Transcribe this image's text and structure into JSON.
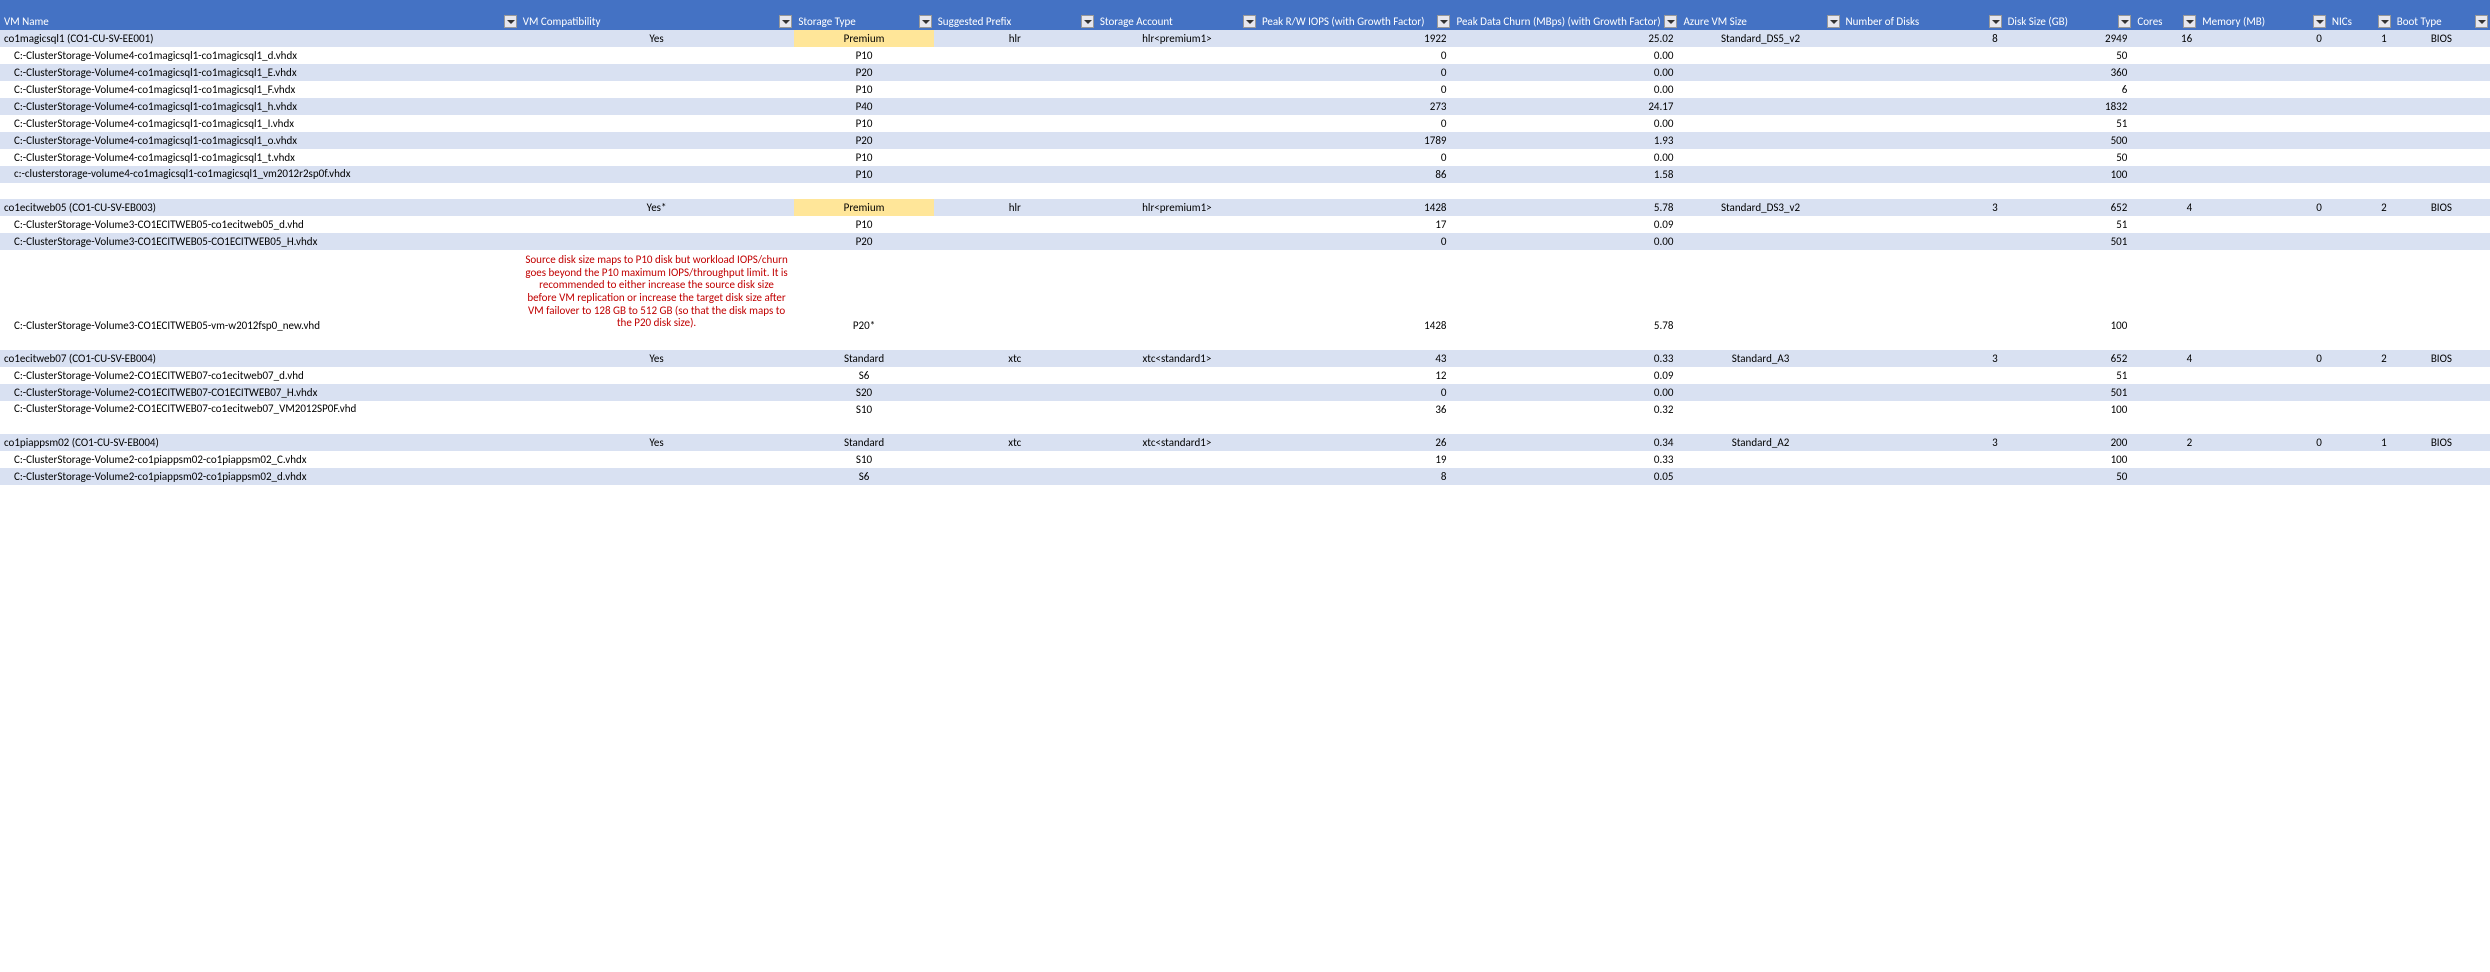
{
  "headers": [
    "VM Name",
    "VM Compatibility",
    "Storage Type",
    "Suggested Prefix",
    "Storage Account",
    "Peak R/W IOPS (with Growth Factor)",
    "Peak Data Churn (MBps) (with Growth Factor)",
    "Azure VM Size",
    "Number of Disks",
    "Disk Size (GB)",
    "Cores",
    "Memory (MB)",
    "NICs",
    "Boot Type"
  ],
  "rows": [
    {
      "band": "a",
      "premium": true,
      "c": [
        "co1magicsql1 (CO1-CU-SV-EE001)",
        "Yes",
        "Premium",
        "hlr",
        "hlr<premium1>",
        "1922",
        "25.02",
        "Standard_DS5_v2",
        "8",
        "2949",
        "16",
        "0",
        "1",
        "BIOS"
      ]
    },
    {
      "band": "b",
      "c": [
        "    C:-ClusterStorage-Volume4-co1magicsql1-co1magicsql1_d.vhdx",
        "",
        "P10",
        "",
        "",
        "0",
        "0.00",
        "",
        "",
        "50",
        "",
        "",
        "",
        ""
      ]
    },
    {
      "band": "a",
      "c": [
        "    C:-ClusterStorage-Volume4-co1magicsql1-co1magicsql1_E.vhdx",
        "",
        "P20",
        "",
        "",
        "0",
        "0.00",
        "",
        "",
        "360",
        "",
        "",
        "",
        ""
      ]
    },
    {
      "band": "b",
      "c": [
        "    C:-ClusterStorage-Volume4-co1magicsql1-co1magicsql1_F.vhdx",
        "",
        "P10",
        "",
        "",
        "0",
        "0.00",
        "",
        "",
        "6",
        "",
        "",
        "",
        ""
      ]
    },
    {
      "band": "a",
      "c": [
        "    C:-ClusterStorage-Volume4-co1magicsql1-co1magicsql1_h.vhdx",
        "",
        "P40",
        "",
        "",
        "273",
        "24.17",
        "",
        "",
        "1832",
        "",
        "",
        "",
        ""
      ]
    },
    {
      "band": "b",
      "c": [
        "    C:-ClusterStorage-Volume4-co1magicsql1-co1magicsql1_I.vhdx",
        "",
        "P10",
        "",
        "",
        "0",
        "0.00",
        "",
        "",
        "51",
        "",
        "",
        "",
        ""
      ]
    },
    {
      "band": "a",
      "c": [
        "    C:-ClusterStorage-Volume4-co1magicsql1-co1magicsql1_o.vhdx",
        "",
        "P20",
        "",
        "",
        "1789",
        "1.93",
        "",
        "",
        "500",
        "",
        "",
        "",
        ""
      ]
    },
    {
      "band": "b",
      "c": [
        "    C:-ClusterStorage-Volume4-co1magicsql1-co1magicsql1_t.vhdx",
        "",
        "P10",
        "",
        "",
        "0",
        "0.00",
        "",
        "",
        "50",
        "",
        "",
        "",
        ""
      ]
    },
    {
      "band": "a",
      "wrap0": true,
      "c": [
        "    c:-clusterstorage-volume4-co1magicsql1-co1magicsql1_vm2012r2sp0f.vhdx",
        "",
        "P10",
        "",
        "",
        "86",
        "1.58",
        "",
        "",
        "100",
        "",
        "",
        "",
        ""
      ]
    },
    {
      "blank": true
    },
    {
      "band": "a",
      "premium": true,
      "c": [
        "co1ecitweb05 (CO1-CU-SV-EB003)",
        "Yes*",
        "Premium",
        "hlr",
        "hlr<premium1>",
        "1428",
        "5.78",
        "Standard_DS3_v2",
        "3",
        "652",
        "4",
        "0",
        "2",
        "BIOS"
      ]
    },
    {
      "band": "b",
      "c": [
        "    C:-ClusterStorage-Volume3-CO1ECITWEB05-co1ecitweb05_d.vhd",
        "",
        "P10",
        "",
        "",
        "17",
        "0.09",
        "",
        "",
        "51",
        "",
        "",
        "",
        ""
      ]
    },
    {
      "band": "a",
      "c": [
        "    C:-ClusterStorage-Volume3-CO1ECITWEB05-CO1ECITWEB05_H.vhdx",
        "",
        "P20",
        "",
        "",
        "0",
        "0.00",
        "",
        "",
        "501",
        "",
        "",
        "",
        ""
      ]
    },
    {
      "band": "b",
      "warn": true,
      "c": [
        "    C:-ClusterStorage-Volume3-CO1ECITWEB05-vm-w2012fsp0_new.vhd",
        "Source disk size maps to P10 disk but workload IOPS/churn goes beyond the P10 maximum IOPS/throughput limit. It is recommended to either increase the source disk size before VM replication or increase the target disk size after VM failover to 128 GB to 512 GB (so that the disk maps to the P20 disk size).",
        "P20*",
        "",
        "",
        "1428",
        "5.78",
        "",
        "",
        "100",
        "",
        "",
        "",
        ""
      ]
    },
    {
      "blank": true
    },
    {
      "band": "a",
      "c": [
        "co1ecitweb07 (CO1-CU-SV-EB004)",
        "Yes",
        "Standard",
        "xtc",
        "xtc<standard1>",
        "43",
        "0.33",
        "Standard_A3",
        "3",
        "652",
        "4",
        "0",
        "2",
        "BIOS"
      ]
    },
    {
      "band": "b",
      "c": [
        "    C:-ClusterStorage-Volume2-CO1ECITWEB07-co1ecitweb07_d.vhd",
        "",
        "S6",
        "",
        "",
        "12",
        "0.09",
        "",
        "",
        "51",
        "",
        "",
        "",
        ""
      ]
    },
    {
      "band": "a",
      "c": [
        "    C:-ClusterStorage-Volume2-CO1ECITWEB07-CO1ECITWEB07_H.vhdx",
        "",
        "S20",
        "",
        "",
        "0",
        "0.00",
        "",
        "",
        "501",
        "",
        "",
        "",
        ""
      ]
    },
    {
      "band": "b",
      "wrap0": true,
      "c": [
        "    C:-ClusterStorage-Volume2-CO1ECITWEB07-co1ecitweb07_VM2012SP0F.vhd",
        "",
        "S10",
        "",
        "",
        "36",
        "0.32",
        "",
        "",
        "100",
        "",
        "",
        "",
        ""
      ]
    },
    {
      "blank": true
    },
    {
      "band": "a",
      "c": [
        "co1piappsm02 (CO1-CU-SV-EB004)",
        "Yes",
        "Standard",
        "xtc",
        "xtc<standard1>",
        "26",
        "0.34",
        "Standard_A2",
        "3",
        "200",
        "2",
        "0",
        "1",
        "BIOS"
      ]
    },
    {
      "band": "b",
      "c": [
        "    C:-ClusterStorage-Volume2-co1piappsm02-co1piappsm02_C.vhdx",
        "",
        "S10",
        "",
        "",
        "19",
        "0.33",
        "",
        "",
        "100",
        "",
        "",
        "",
        ""
      ]
    },
    {
      "band": "a",
      "c": [
        "    C:-ClusterStorage-Volume2-co1piappsm02-co1piappsm02_d.vhdx",
        "",
        "S6",
        "",
        "",
        "8",
        "0.05",
        "",
        "",
        "50",
        "",
        "",
        "",
        ""
      ]
    }
  ],
  "numericCols": [
    5,
    6,
    8,
    9,
    10,
    11,
    12
  ],
  "centerCols": [
    1,
    2,
    3,
    4,
    7,
    13
  ]
}
